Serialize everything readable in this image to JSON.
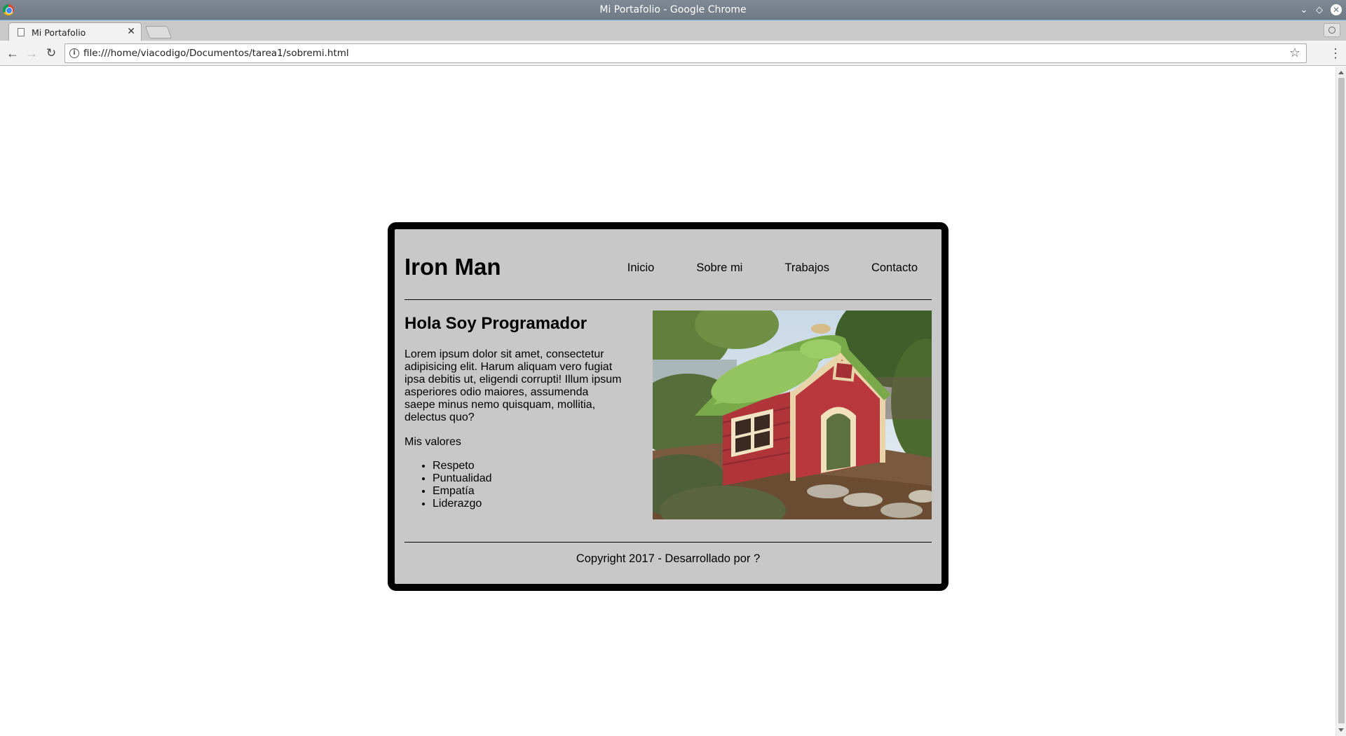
{
  "window": {
    "title": "Mi Portafolio - Google Chrome"
  },
  "tab": {
    "label": "Mi Portafolio",
    "close_glyph": "✕"
  },
  "toolbar": {
    "url": "file:///home/viacodigo/Documentos/tarea1/sobremi.html",
    "back_glyph": "←",
    "forward_glyph": "→",
    "reload_glyph": "↻",
    "star_glyph": "☆",
    "menu_glyph": "⋮",
    "info_glyph": "i"
  },
  "page": {
    "site_title": "Iron Man",
    "nav": [
      "Inicio",
      "Sobre mi",
      "Trabajos",
      "Contacto"
    ],
    "heading": "Hola Soy Programador",
    "intro_text": "Lorem ipsum dolor sit amet, consectetur adipisicing elit. Harum aliquam vero fugiat ipsa debitis ut, eligendi corrupti! Illum ipsum asperiores odio maiores, assumenda saepe minus nemo quisquam, mollitia, delectus quo?",
    "values_title": "Mis valores",
    "values": [
      "Respeto",
      "Puntualidad",
      "Empatía",
      "Liderazgo"
    ],
    "footer": "Copyright 2017 - Desarrollado por ?"
  },
  "colors": {
    "card_background": "#c8c8c8",
    "card_border": "#000000",
    "titlebar": "#737e89"
  },
  "icons": {
    "app": "chrome-icon",
    "tab_page": "page-icon",
    "photo": "doghouse-photo"
  }
}
